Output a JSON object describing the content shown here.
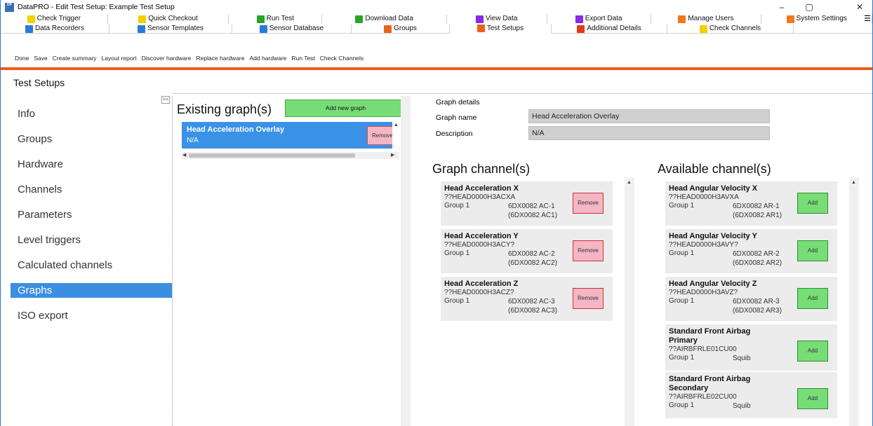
{
  "window": {
    "title": "DataPRO - Edit Test Setup: Example Test Setup",
    "icon_text": "Data PRO",
    "minimize": "–",
    "maximize": "▢",
    "close": "✕"
  },
  "tabs": {
    "row0": [
      {
        "label": "Check Trigger",
        "icon_color": "#f5d000"
      },
      {
        "label": "Quick Checkout",
        "icon_color": "#f5d000"
      },
      {
        "label": "Run Test",
        "icon_color": "#27a627"
      },
      {
        "label": "Download Data",
        "icon_color": "#27a627"
      },
      {
        "label": "View Data",
        "icon_color": "#8a2be2"
      },
      {
        "label": "Export Data",
        "icon_color": "#8a2be2"
      },
      {
        "label": "Manage Users",
        "icon_color": "#f07a1a"
      },
      {
        "label": "System Settings",
        "icon_color": "#f07a1a"
      }
    ],
    "row1": [
      {
        "label": "Data Recorders",
        "icon_color": "#2a7bd8"
      },
      {
        "label": "Sensor Templates",
        "icon_color": "#2a7bd8"
      },
      {
        "label": "Sensor Database",
        "icon_color": "#2a7bd8"
      },
      {
        "label": "Groups",
        "icon_color": "#e8641a"
      },
      {
        "label": "Test Setups",
        "icon_color": "#e8641a"
      },
      {
        "label": "Additional Details",
        "icon_color": "#e03a1a"
      },
      {
        "label": "Check Channels",
        "icon_color": "#f5d000"
      }
    ],
    "overflow": "☰"
  },
  "toolbar": [
    "Done",
    "Save",
    "Create summary",
    "Layout report",
    "Discover hardware",
    "Replace hardware",
    "Add hardware",
    "Run Test",
    "Check Channels"
  ],
  "section_title": "Test Setups",
  "collapse_label": "<<",
  "nav": [
    "Info",
    "Groups",
    "Hardware",
    "Channels",
    "Parameters",
    "Level triggers",
    "Calculated channels",
    "Graphs",
    "ISO export"
  ],
  "nav_selected": "Graphs",
  "existing": {
    "title": "Existing graph(s)",
    "add_label": "Add new graph",
    "graphs": [
      {
        "name": "Head Acceleration Overlay",
        "description": "N/A",
        "remove_label": "Remove"
      }
    ]
  },
  "details": {
    "label": "Graph details",
    "name_label": "Graph name",
    "name_value": "Head Acceleration Overlay",
    "desc_label": "Description",
    "desc_value": "N/A"
  },
  "graph_channels": {
    "title": "Graph channel(s)",
    "items": [
      {
        "name": "Head Acceleration X",
        "id": "??HEAD0000H3ACXA",
        "group": "Group 1",
        "device": "6DX0082 AC-1",
        "device2": "(6DX0082 AC1)",
        "button": "Remove"
      },
      {
        "name": "Head Acceleration Y",
        "id": "??HEAD0000H3ACY?",
        "group": "Group 1",
        "device": "6DX0082 AC-2",
        "device2": "(6DX0082 AC2)",
        "button": "Remove"
      },
      {
        "name": "Head Acceleration Z",
        "id": "??HEAD0000H3ACZ?",
        "group": "Group 1",
        "device": "6DX0082 AC-3",
        "device2": "(6DX0082 AC3)",
        "button": "Remove"
      }
    ]
  },
  "available_channels": {
    "title": "Available channel(s)",
    "items": [
      {
        "name": "Head Angular Velocity X",
        "name2": "",
        "id": "??HEAD0000H3AVXA",
        "group": "Group 1",
        "device": "6DX0082 AR-1",
        "device2": "(6DX0082 AR1)",
        "button": "Add"
      },
      {
        "name": "Head Angular Velocity Y",
        "name2": "",
        "id": "??HEAD0000H3AVY?",
        "group": "Group 1",
        "device": "6DX0082 AR-2",
        "device2": "(6DX0082 AR2)",
        "button": "Add"
      },
      {
        "name": "Head Angular Velocity Z",
        "name2": "",
        "id": "??HEAD0000H3AVZ?",
        "group": "Group 1",
        "device": "6DX0082 AR-3",
        "device2": "(6DX0082 AR3)",
        "button": "Add"
      },
      {
        "name": "Standard Front Airbag",
        "name2": "Primary",
        "id": "??AIRBFRLE01CU00",
        "group": "Group 1",
        "device": "Squib",
        "device2": "",
        "button": "Add"
      },
      {
        "name": "Standard Front Airbag",
        "name2": "Secondary",
        "id": "??AIRBFRLE02CU00",
        "group": "Group 1",
        "device": "Squib",
        "device2": "",
        "button": "Add"
      }
    ]
  },
  "colors": {
    "accent_bar": "#f05a1a",
    "selection": "#3b8ee0",
    "add_button": "#77dd77",
    "remove_button": "#f4b6c2"
  }
}
